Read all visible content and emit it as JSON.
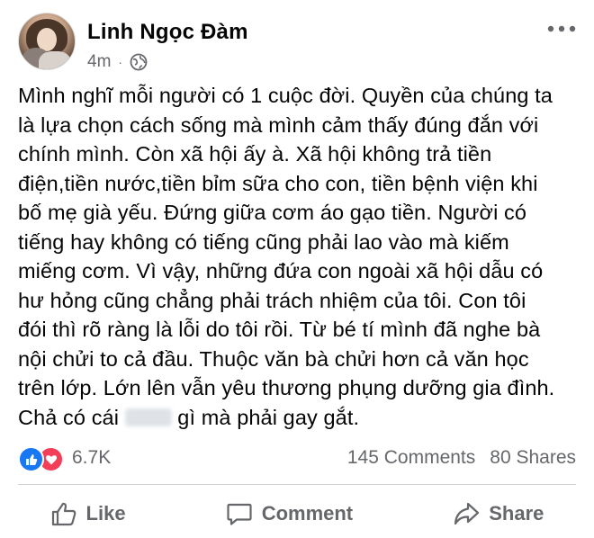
{
  "post": {
    "author": "Linh Ngọc Đàm",
    "time": "4m",
    "separator": "·",
    "text_lines": [
      "Mình nghĩ mỗi người có 1 cuộc đời. Quyền của chúng ta",
      "là lựa chọn cách sống mà mình cảm thấy đúng đắn với",
      "chính mình. Còn xã hội ấy à. Xã hội không trả tiền",
      "điện,tiền nước,tiền bỉm sữa cho con, tiền bệnh viện khi",
      "bố mẹ già yếu. Đứng giữa cơm áo gạo tiền. Người có",
      "tiếng hay không có tiếng cũng phải lao vào mà kiếm",
      "miếng cơm. Vì vậy, những đứa con ngoài xã hội dẫu có",
      "hư hỏng cũng chẳng phải trách nhiệm của tôi. Con tôi",
      "đói thì rõ ràng là lỗi do tôi rồi. Từ bé tí mình đã nghe bà",
      "nội chửi to cả đầu. Thuộc văn bà chửi hơn cả văn học",
      "trên lớp. Lớn lên vẫn yêu thương phụng dưỡng gia đình."
    ],
    "last_line_before": "Chả có cái ",
    "last_line_after": " gì mà phải gay gắt."
  },
  "engagement": {
    "reaction_count": "6.7K",
    "comments": "145 Comments",
    "shares": "80 Shares"
  },
  "actions": {
    "like": "Like",
    "comment": "Comment",
    "share": "Share"
  },
  "colors": {
    "like_blue": "#1877f2",
    "love_red": "#f33e58",
    "secondary_text": "#65676b"
  },
  "icons": [
    "globe-icon",
    "more-icon",
    "like-reaction-icon",
    "love-reaction-icon",
    "thumbs-up-icon",
    "comment-icon",
    "share-icon"
  ]
}
